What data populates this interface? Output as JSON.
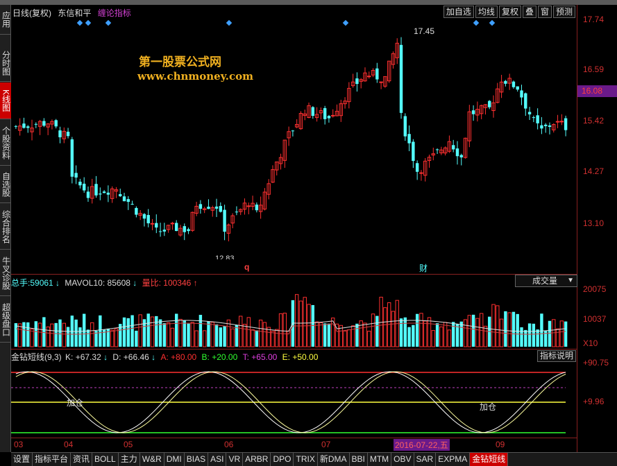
{
  "window": {
    "period": "日线(复权)",
    "stock_name": "东信和平",
    "indicator_name": "缠论指标"
  },
  "toolbar": [
    "加自选",
    "均线",
    "复权",
    "叠",
    "窗",
    "预测"
  ],
  "sidebar": [
    {
      "label": "应用",
      "active": false
    },
    {
      "label": "分时图",
      "active": false
    },
    {
      "label": "K线图",
      "active": true
    },
    {
      "label": "个股资料",
      "active": false
    },
    {
      "label": "自选股",
      "active": false
    },
    {
      "label": "综合排名",
      "active": false
    },
    {
      "label": "牛叉诊股",
      "active": false
    },
    {
      "label": "超级盘口",
      "active": false
    }
  ],
  "watermark": {
    "line1": "第一股票公式网",
    "line2": "www.chnmoney.com"
  },
  "price_axis": {
    "labels": [
      "17.74",
      "16.59",
      "15.42",
      "14.27",
      "13.10"
    ],
    "current": "16.08"
  },
  "price_annotations": {
    "high": "17.45",
    "low": "12.83"
  },
  "markers": {
    "q": "q",
    "cai": "财"
  },
  "volume": {
    "total_label": "总手:",
    "total_value": "59061",
    "mavol_label": "MAVOL10:",
    "mavol_value": "85608",
    "ratio_label": "量比:",
    "ratio_value": "100346",
    "select_label": "成交量",
    "axis": [
      "20075",
      "10037",
      "X10"
    ]
  },
  "indicator": {
    "name": "金钻短线(9,3)",
    "k": "K: +67.32",
    "d": "D: +66.46",
    "a": "A: +80.00",
    "b": "B: +20.00",
    "t": "T: +65.00",
    "e": "E: +50.00",
    "axis": [
      "+90.75",
      "+9.96"
    ],
    "button": "指标说明",
    "jiacang": "加仓"
  },
  "dates": {
    "labels": [
      "03",
      "04",
      "05",
      "06",
      "07",
      "09"
    ],
    "highlight": "2016-07-22,五"
  },
  "bottom_tabs": [
    "设置",
    "指标平台",
    "资讯",
    "BOLL",
    "主力",
    "W&R",
    "DMI",
    "BIAS",
    "ASI",
    "VR",
    "ARBR",
    "DPO",
    "TRIX",
    "新DMA",
    "BBI",
    "MTM",
    "OBV",
    "SAR",
    "EXPMA",
    "金钻短线"
  ],
  "colors": {
    "up": "#ff3030",
    "down": "#54ffff",
    "axis_line": "#8a2020",
    "accent": "#6a1a8a"
  }
}
